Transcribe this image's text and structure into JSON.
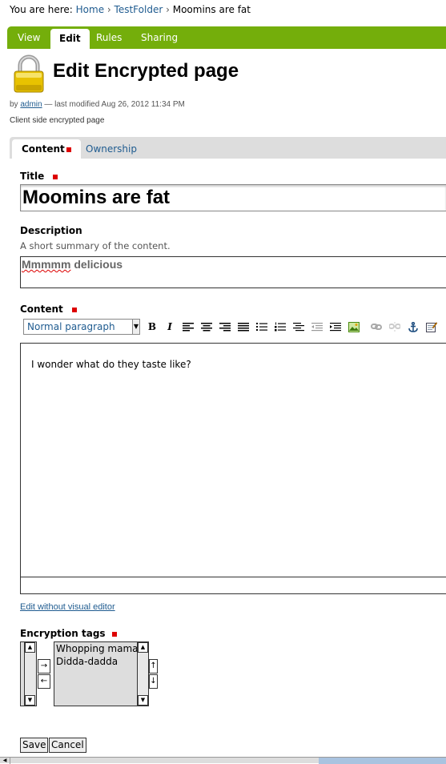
{
  "breadcrumb": {
    "prefix": "You are here:",
    "items": [
      "Home",
      "TestFolder",
      "Moomins are fat"
    ],
    "separator": "›"
  },
  "top_tabs": [
    "View",
    "Edit",
    "Rules",
    "Sharing"
  ],
  "active_top_tab": "Edit",
  "page_title": "Edit Encrypted page",
  "byline": {
    "by": "by",
    "author": "admin",
    "modified": "— last modified Aug 26, 2012 11:34 PM"
  },
  "type_description": "Client side encrypted page",
  "form_tabs": [
    "Content",
    "Ownership"
  ],
  "title_field": {
    "label": "Title",
    "value": "Moomins are fat"
  },
  "description_field": {
    "label": "Description",
    "help": "A short summary of the content.",
    "value_word1": "Mmmmm",
    "value_rest": " delicious"
  },
  "content_field": {
    "label": "Content",
    "format": "Normal paragraph",
    "body": "I wonder what do they taste like?",
    "toolbar_icons": [
      "bold-icon",
      "italic-icon",
      "align-left-icon",
      "align-center-icon",
      "align-right-icon",
      "align-justify-icon",
      "bullet-list-icon",
      "numbered-list-icon",
      "definition-list-icon",
      "outdent-icon",
      "indent-icon",
      "insert-image-icon",
      "link-icon",
      "unlink-icon",
      "anchor-icon",
      "edit-source-icon"
    ]
  },
  "edit_without_visual": "Edit without visual editor",
  "encryption_tags": {
    "label": "Encryption tags",
    "selected": [
      "Whopping mama",
      "Didda-dadda"
    ],
    "move_right": "→",
    "move_left": "←",
    "move_up": "↑",
    "move_down": "↓"
  },
  "buttons": {
    "save": "Save",
    "cancel": "Cancel"
  },
  "colors": {
    "tabbar": "#74ae0b",
    "link": "#205c90",
    "required": "#dd0000"
  }
}
